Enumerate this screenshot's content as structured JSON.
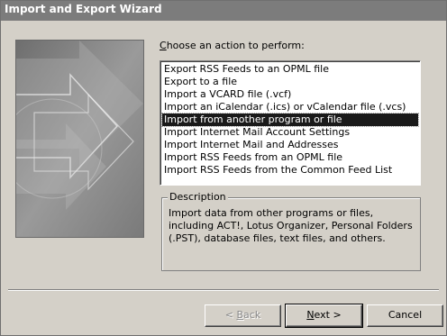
{
  "window": {
    "title": "Import and Export Wizard"
  },
  "prompt": {
    "accel": "C",
    "rest": "hoose an action to perform:"
  },
  "actions": {
    "items": [
      "Export RSS Feeds to an OPML file",
      "Export to a file",
      "Import a VCARD file (.vcf)",
      "Import an iCalendar (.ics) or vCalendar file (.vcs)",
      "Import from another program or file",
      "Import Internet Mail Account Settings",
      "Import Internet Mail and Addresses",
      "Import RSS Feeds from an OPML file",
      "Import RSS Feeds from the Common Feed List"
    ],
    "selected_index": 4
  },
  "description": {
    "legend": "Description",
    "text": "Import data from other programs or files, including ACT!, Lotus Organizer, Personal Folders (.PST), database files, text files, and others."
  },
  "buttons": {
    "back": {
      "prefix": "< ",
      "accel": "B",
      "rest": "ack"
    },
    "next": {
      "accel": "N",
      "rest": "ext >"
    },
    "cancel": {
      "label": "Cancel"
    }
  }
}
